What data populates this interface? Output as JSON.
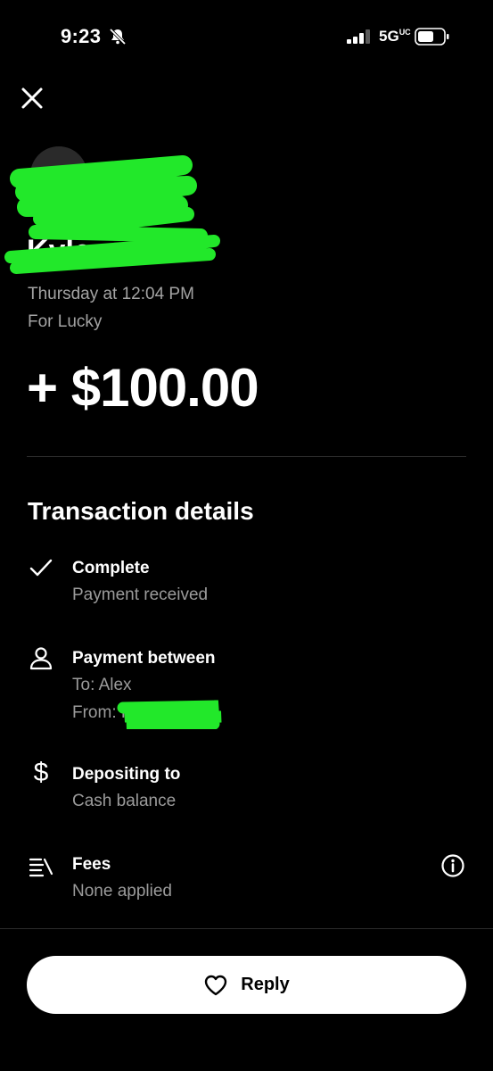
{
  "status_bar": {
    "time": "9:23",
    "network": "5G",
    "network_suffix": "UC"
  },
  "icons": {
    "close": "close-icon",
    "bell_muted": "bell-slash-icon",
    "complete": "checkmark-icon",
    "person": "person-icon",
    "dollar": "dollar-icon",
    "fees": "list-icon",
    "info": "info-icon",
    "heart": "heart-icon"
  },
  "header": {
    "sender_name_visible": "Kyle",
    "date": "Thursday at 12:04 PM",
    "note": "For Lucky",
    "amount": "+ $100.00"
  },
  "details": {
    "title": "Transaction details",
    "status": {
      "title": "Complete",
      "subtitle": "Payment received"
    },
    "parties": {
      "title": "Payment between",
      "to": "To: Alex",
      "from": "From: K"
    },
    "deposit": {
      "title": "Depositing to",
      "subtitle": "Cash balance"
    },
    "fees": {
      "title": "Fees",
      "subtitle": "None applied"
    }
  },
  "footer": {
    "reply_label": "Reply"
  },
  "colors": {
    "background": "#000000",
    "secondary_text": "#9b9b9b",
    "redaction_green": "#22e82a",
    "button_bg": "#ffffff"
  }
}
